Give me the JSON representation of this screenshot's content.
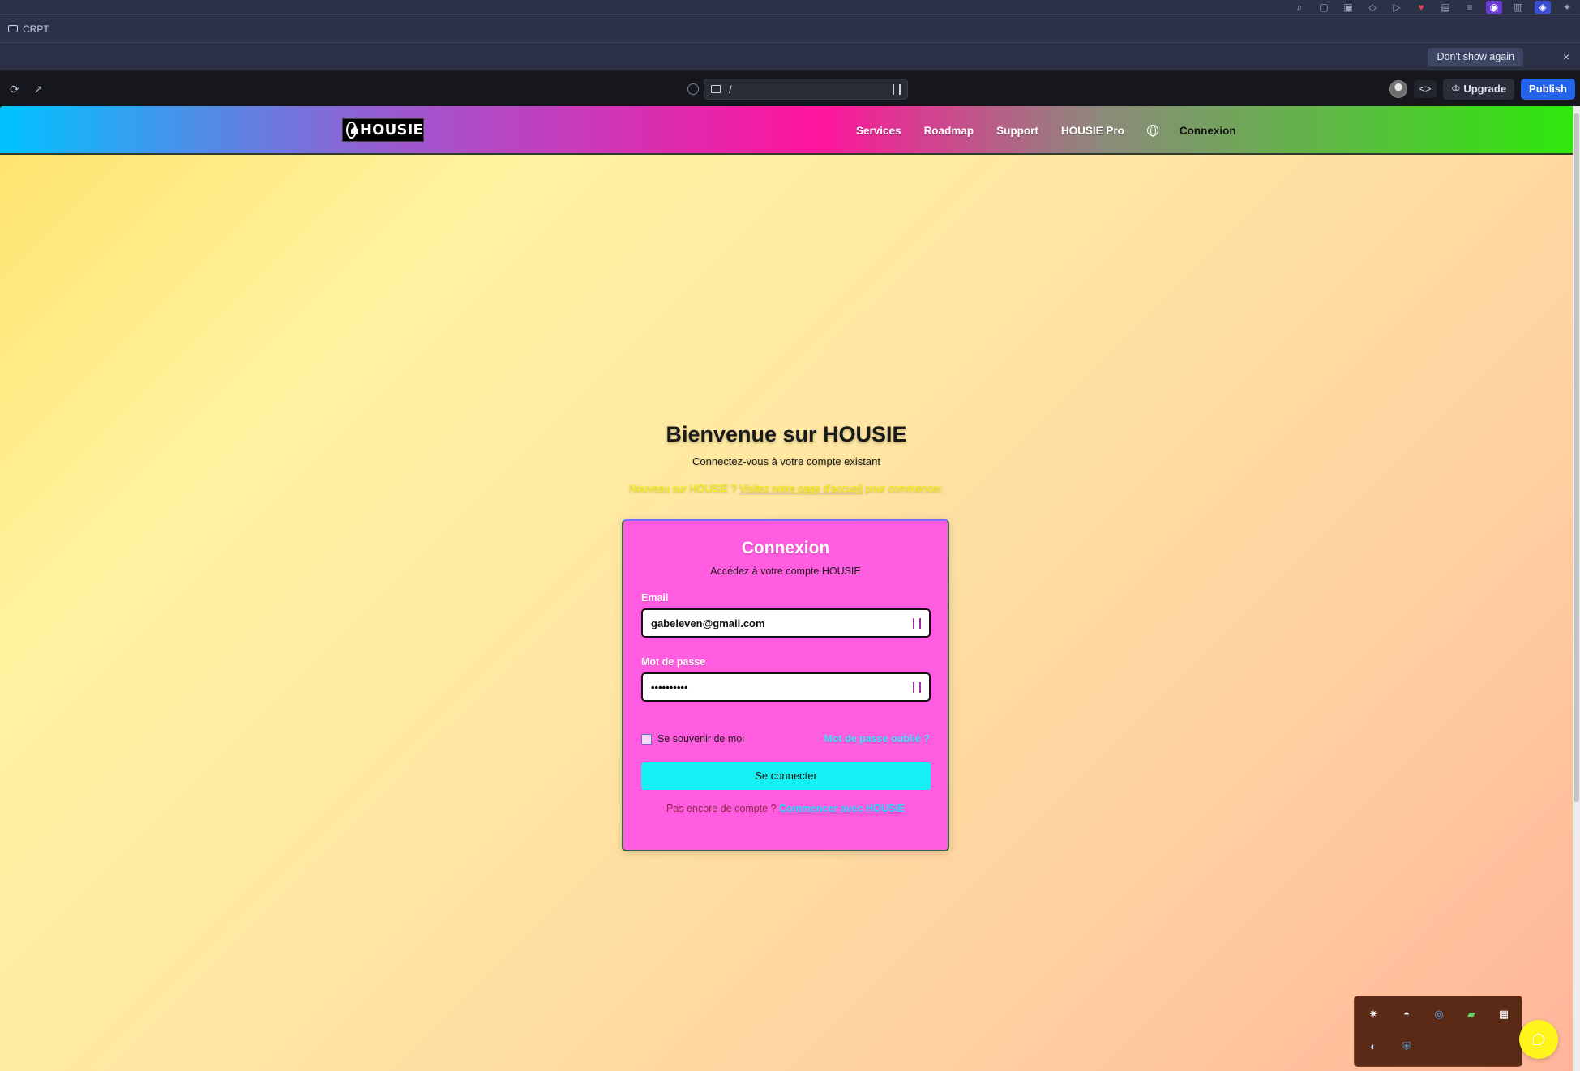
{
  "browser": {
    "folder_label": "CRPT",
    "notice": {
      "dont_show_label": "Don't show again",
      "close_glyph": "×"
    },
    "url_path": "/",
    "upgrade_label": "Upgrade",
    "publish_label": "Publish",
    "code_glyph": "<>",
    "reload_glyph": "⟳",
    "open_glyph": "↗",
    "upgrade_icon": "crown-icon"
  },
  "site": {
    "logo_text": "HOUSIE",
    "nav": [
      "Services",
      "Roadmap",
      "Support",
      "HOUSIE Pro"
    ],
    "nav_login": "Connexion"
  },
  "hero": {
    "title": "Bienvenue sur HOUSIE",
    "subtitle": "Connectez-vous à votre compte existant",
    "note_prefix": "Nouveau sur HOUSIE ? ",
    "note_link": "Visitez notre page d'accueil",
    "note_suffix": " pour commencer."
  },
  "login_card": {
    "title": "Connexion",
    "subtitle": "Accédez à votre compte HOUSIE",
    "email_label": "Email",
    "email_value": "gabeleven@gmail.com",
    "password_label": "Mot de passe",
    "password_value": "••••••••••",
    "remember_label": "Se souvenir de moi",
    "remember_checked": false,
    "forgot_label": "Mot de passe oublié ?",
    "submit_label": "Se connecter",
    "signup_prefix": "Pas encore de compte ? ",
    "signup_link": "Commencer avec HOUSIE"
  },
  "colors": {
    "nav_gradient": [
      "#00c3ff",
      "#9b59d0",
      "#ff149d",
      "#2ee80c"
    ],
    "card_bg": "#ff5ce0",
    "submit_bg": "#14f1f5",
    "publish_bg": "#2563eb",
    "chat_bg": "#fff51a"
  }
}
